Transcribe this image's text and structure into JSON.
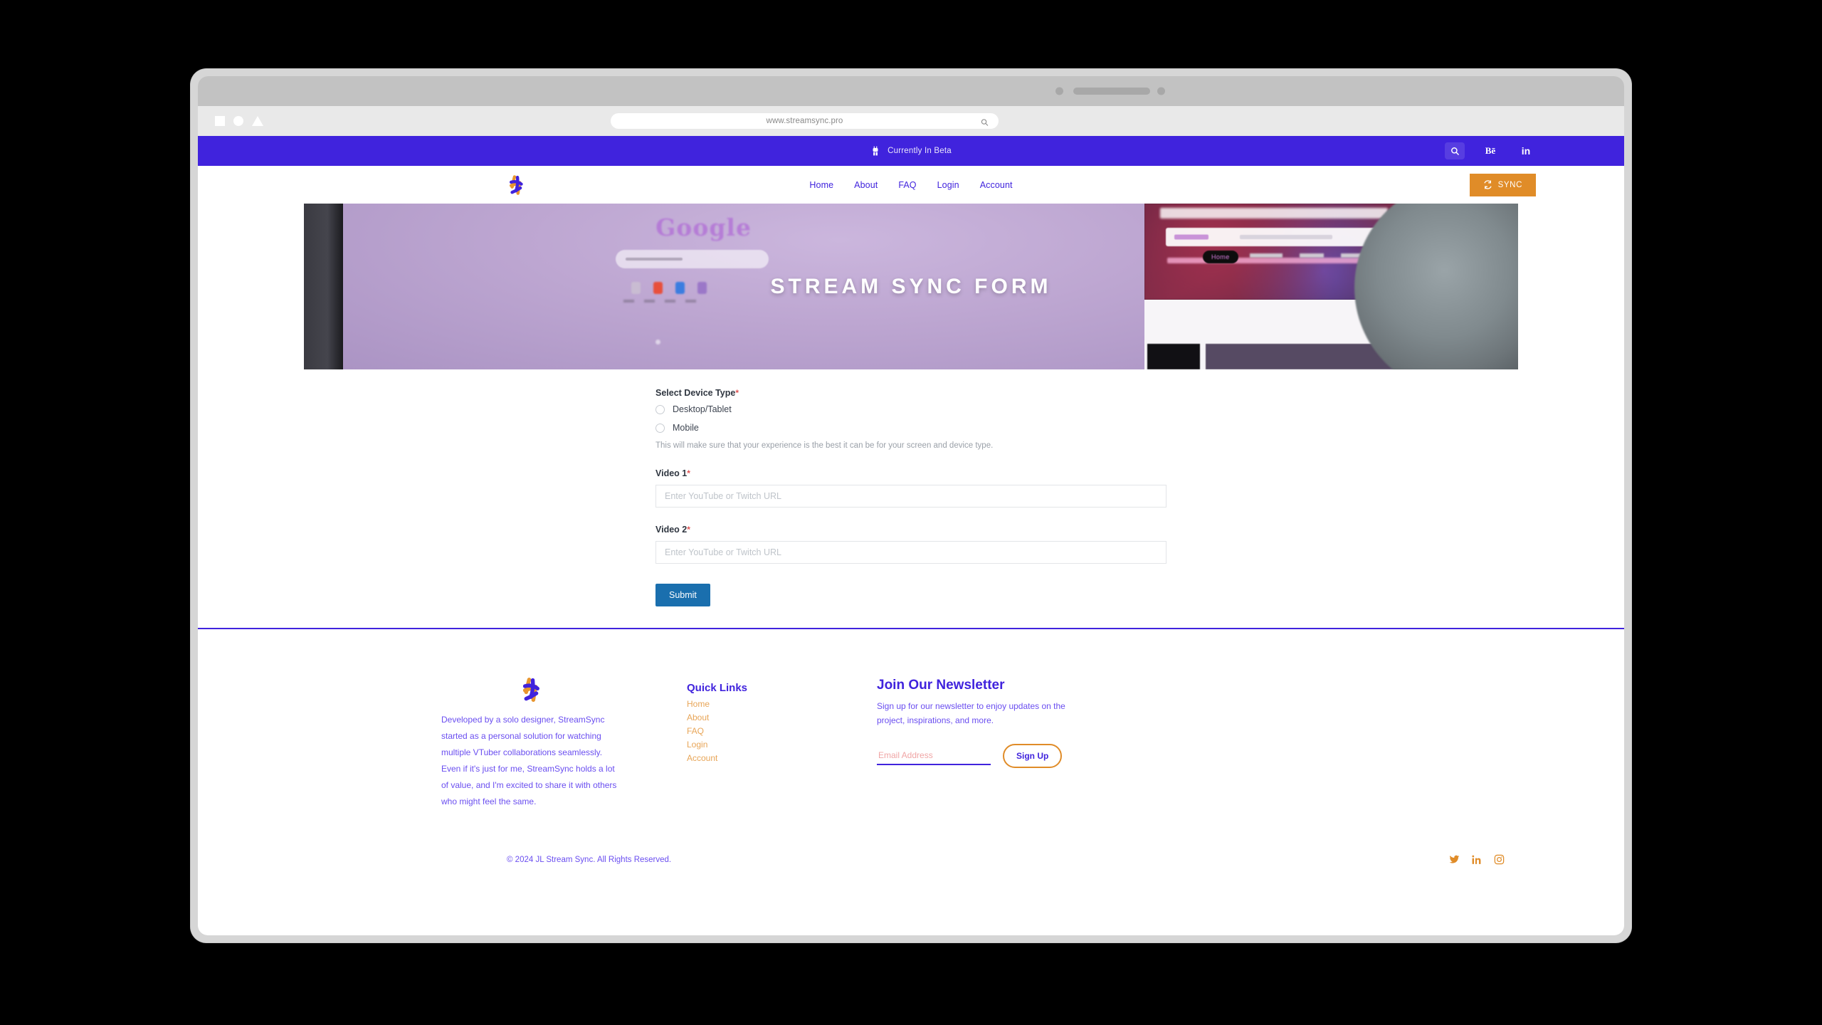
{
  "browser": {
    "url": "www.streamsync.pro",
    "window_shapes": [
      "square-icon",
      "circle-icon",
      "triangle-icon"
    ],
    "url_search_icon": "search-icon"
  },
  "beta_bar": {
    "icon": "robot-icon",
    "text": "Currently In Beta",
    "actions": [
      {
        "name": "search-icon",
        "label": ""
      },
      {
        "name": "behance-icon",
        "label": "Bē"
      },
      {
        "name": "linkedin-icon",
        "label": "in"
      }
    ]
  },
  "navbar": {
    "logo": "streamsync-logo",
    "links": [
      {
        "label": "Home"
      },
      {
        "label": "About"
      },
      {
        "label": "FAQ"
      },
      {
        "label": "Login"
      },
      {
        "label": "Account"
      }
    ],
    "sync_button": {
      "label": "SYNC",
      "icon": "refresh-icon"
    }
  },
  "hero": {
    "title": "STREAM SYNC FORM"
  },
  "form": {
    "device_type": {
      "label": "Select Device Type",
      "required_marker": "*",
      "options": [
        {
          "label": "Desktop/Tablet",
          "selected": false
        },
        {
          "label": "Mobile",
          "selected": false
        }
      ],
      "help": "This will make sure that your experience is the best it can be for your screen and device type."
    },
    "video1": {
      "label": "Video 1",
      "required_marker": "*",
      "value": "",
      "placeholder": "Enter YouTube or Twitch URL"
    },
    "video2": {
      "label": "Video 2",
      "required_marker": "*",
      "value": "",
      "placeholder": "Enter YouTube or Twitch URL"
    },
    "submit_label": "Submit"
  },
  "footer": {
    "logo": "streamsync-logo",
    "about_text": "Developed by a solo designer, StreamSync started as a personal solution for watching multiple VTuber collaborations seamlessly. Even if it's just for me, StreamSync holds a lot of value, and I'm excited to share it with others who might feel the same.",
    "quick_links": {
      "title": "Quick Links",
      "items": [
        {
          "label": "Home"
        },
        {
          "label": "About"
        },
        {
          "label": "FAQ"
        },
        {
          "label": "Login"
        },
        {
          "label": "Account"
        }
      ]
    },
    "newsletter": {
      "title": "Join Our Newsletter",
      "subtitle": "Sign up for our newsletter to enjoy updates on the project, inspirations, and more.",
      "email_value": "",
      "email_placeholder": "Email Address",
      "button_label": "Sign Up"
    },
    "copyright": "© 2024 JL Stream Sync. All Rights Reserved.",
    "socials": [
      {
        "name": "twitter-icon"
      },
      {
        "name": "linkedin-icon"
      },
      {
        "name": "instagram-icon"
      }
    ]
  },
  "colors": {
    "indigo": "#4023dd",
    "orange": "#e08c28",
    "link_orange": "#e8a557",
    "submit_blue": "#1a6fae",
    "violet_text": "#6a4ef0",
    "required_red": "#e05252"
  }
}
